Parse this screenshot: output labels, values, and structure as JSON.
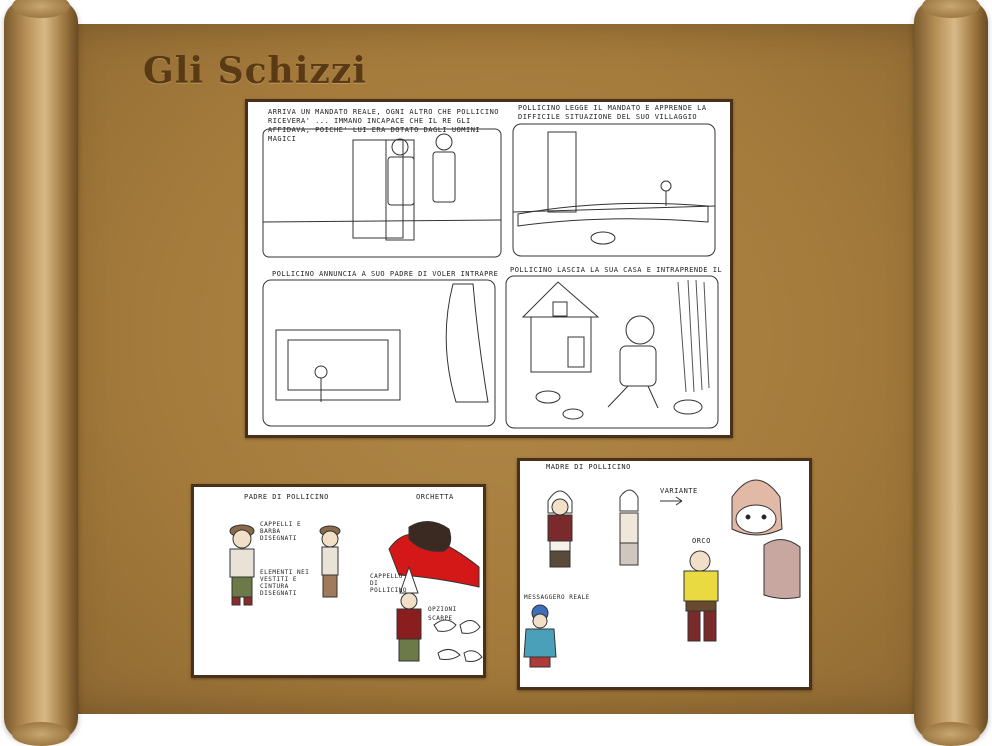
{
  "page": {
    "title": "Gli Schizzi"
  },
  "storyboard": {
    "panels": [
      {
        "caption": "ARRIVA UN MANDATO REALE, OGNI ALTRO CHE POLLICINO RICEVERA' ... IMMANO INCAPACE CHE IL RE GLI AFFIDAVA, POICHE' LUI ERA DOTATO DAGLI UOMINI MAGICI"
      },
      {
        "caption": "POLLICINO LEGGE IL MANDATO E APPRENDE LA DIFFICILE SITUAZIONE DEL SUO VILLAGGIO"
      },
      {
        "caption": "POLLICINO ANNUNCIA A SUO PADRE DI VOLER INTRAPRENDERE IL VIAGGIO"
      },
      {
        "caption": "POLLICINO LASCIA LA SUA CASA E INTRAPRENDE IL VIAGGIO"
      }
    ]
  },
  "sheet_left": {
    "label_father": "PADRE DI POLLICINO",
    "label_ogre": "ORCHETTA",
    "note_hat": "CAPPELLI E BARBA DISEGNATI",
    "note_clothes": "ELEMENTI NEI VESTITI E CINTURA DISEGNATI",
    "label_hat": "CAPPELLO DI POLLICINO",
    "label_options": "OPZIONI SCARPE"
  },
  "sheet_right": {
    "label_mother": "MADRE DI POLLICINO",
    "label_variant": "VARIANTE",
    "label_ogre": "ORCO",
    "label_messenger": "MESSAGGERO REALE"
  }
}
